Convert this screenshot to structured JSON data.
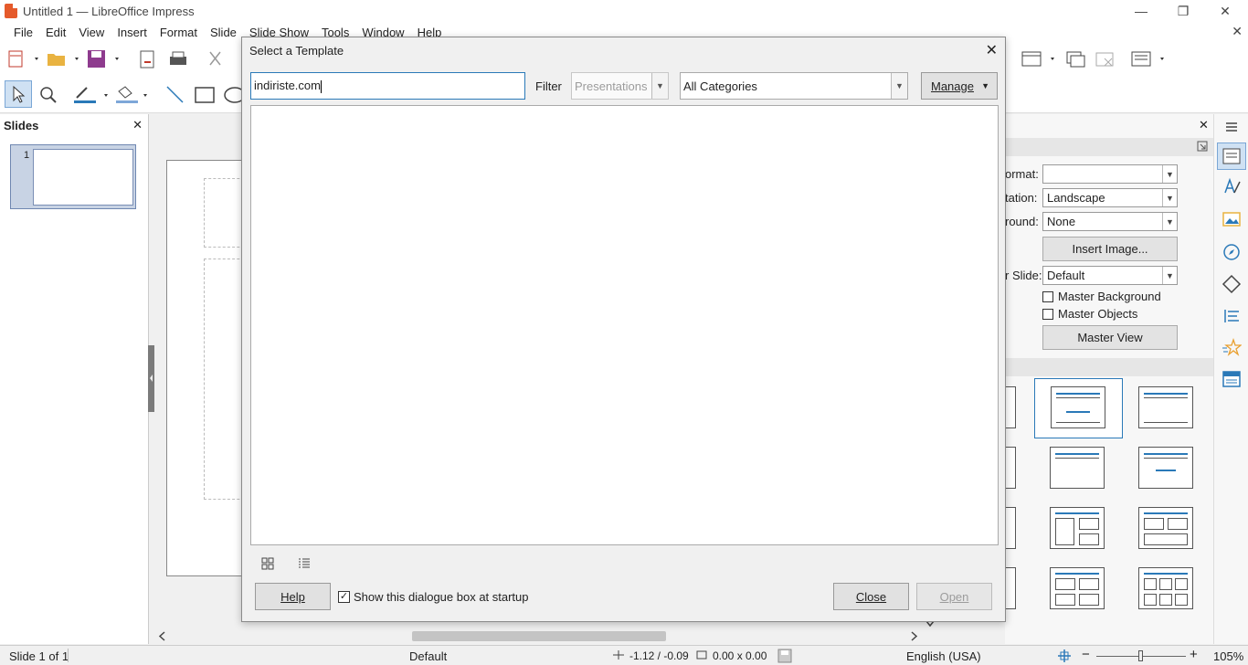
{
  "window": {
    "title": "Untitled 1 — LibreOffice Impress",
    "minimize": "—",
    "restore": "❐",
    "close": "✕",
    "doc_close": "✕"
  },
  "menu": [
    "File",
    "Edit",
    "View",
    "Insert",
    "Format",
    "Slide",
    "Slide Show",
    "Tools",
    "Window",
    "Help"
  ],
  "slides_pane": {
    "title": "Slides",
    "close": "✕",
    "slide_number": "1"
  },
  "sidebar": {
    "close": "✕",
    "format_label": "ormat:",
    "format_value": "",
    "orientation_label": "tation:",
    "orientation_value": "Landscape",
    "background_label": "round:",
    "background_value": "None",
    "insert_image": "Insert Image...",
    "master_slide_label": "r Slide:",
    "master_slide_value": "Default",
    "master_background": "Master Background",
    "master_objects": "Master Objects",
    "master_view": "Master View"
  },
  "dialog": {
    "title": "Select a Template",
    "close": "✕",
    "search_value": "indiriste.com",
    "filter_label": "Filter",
    "filter_value": "Presentations",
    "category_value": "All Categories",
    "manage": "Manage",
    "help": "Help",
    "show_at_startup": "Show this dialogue box at startup",
    "show_at_startup_checked": "✓",
    "close_button": "Close",
    "open_button": "Open"
  },
  "status": {
    "slide": "Slide 1 of 1",
    "master": "Default",
    "position": "-1.12 / -0.09",
    "size": "0.00 x 0.00",
    "language": "English (USA)",
    "zoom": "105%"
  },
  "colors": {
    "accent": "#2a79b8",
    "app_logo": "#e55a2b"
  }
}
